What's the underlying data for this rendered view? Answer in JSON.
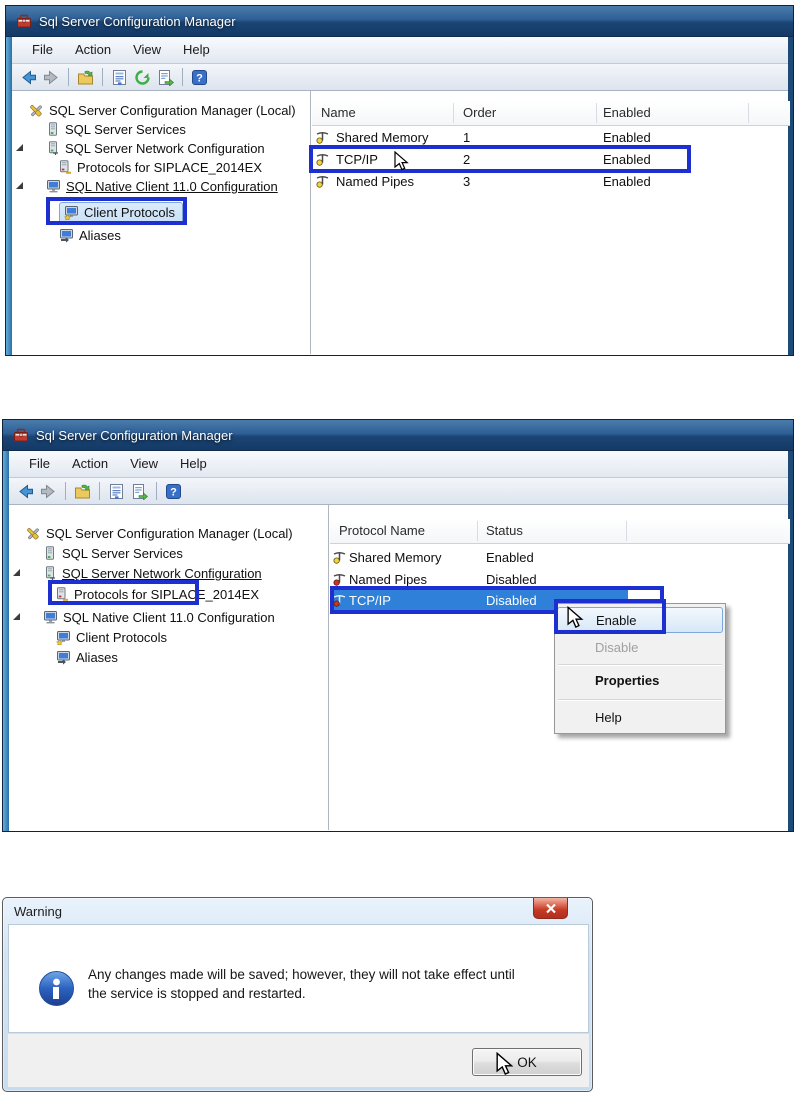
{
  "window_top": {
    "title": "Sql Server Configuration Manager",
    "menu": {
      "file": "File",
      "action": "Action",
      "view": "View",
      "help": "Help"
    },
    "tree": {
      "root": "SQL Server Configuration Manager (Local)",
      "services": "SQL Server Services",
      "network_config": "SQL Server Network Configuration",
      "protocols_instance": "Protocols for SIPLACE_2014EX",
      "native_client": "SQL Native Client 11.0 Configuration",
      "client_protocols": "Client Protocols",
      "aliases": "Aliases"
    },
    "list": {
      "col_name": "Name",
      "col_order": "Order",
      "col_enabled": "Enabled",
      "rows": [
        {
          "name": "Shared Memory",
          "order": "1",
          "enabled": "Enabled"
        },
        {
          "name": "TCP/IP",
          "order": "2",
          "enabled": "Enabled"
        },
        {
          "name": "Named Pipes",
          "order": "3",
          "enabled": "Enabled"
        }
      ]
    }
  },
  "window_middle": {
    "title": "Sql Server Configuration Manager",
    "menu": {
      "file": "File",
      "action": "Action",
      "view": "View",
      "help": "Help"
    },
    "tree": {
      "root": "SQL Server Configuration Manager (Local)",
      "services": "SQL Server Services",
      "network_config": "SQL Server Network Configuration",
      "protocols_instance": "Protocols for SIPLACE_2014EX",
      "native_client": "SQL Native Client 11.0 Configuration",
      "client_protocols": "Client Protocols",
      "aliases": "Aliases"
    },
    "list": {
      "col_name": "Protocol Name",
      "col_status": "Status",
      "rows": [
        {
          "name": "Shared Memory",
          "status": "Enabled"
        },
        {
          "name": "Named Pipes",
          "status": "Disabled"
        },
        {
          "name": "TCP/IP",
          "status": "Disabled"
        }
      ]
    },
    "context_menu": {
      "enable": "Enable",
      "disable": "Disable",
      "properties": "Properties",
      "help": "Help"
    }
  },
  "dialog": {
    "title": "Warning",
    "message_line1": "Any changes made will be saved; however, they will not take effect until",
    "message_line2": "the service is stopped and restarted.",
    "ok": "OK"
  },
  "icons": {
    "help_glyph": "?"
  },
  "colors": {
    "annotation_blue": "#1d30cf",
    "selection_blue": "#2e80d9",
    "titlebar_blue": "#2e5f96",
    "enabled_dot": "#f2d53a",
    "disabled_dot": "#d0331f"
  }
}
